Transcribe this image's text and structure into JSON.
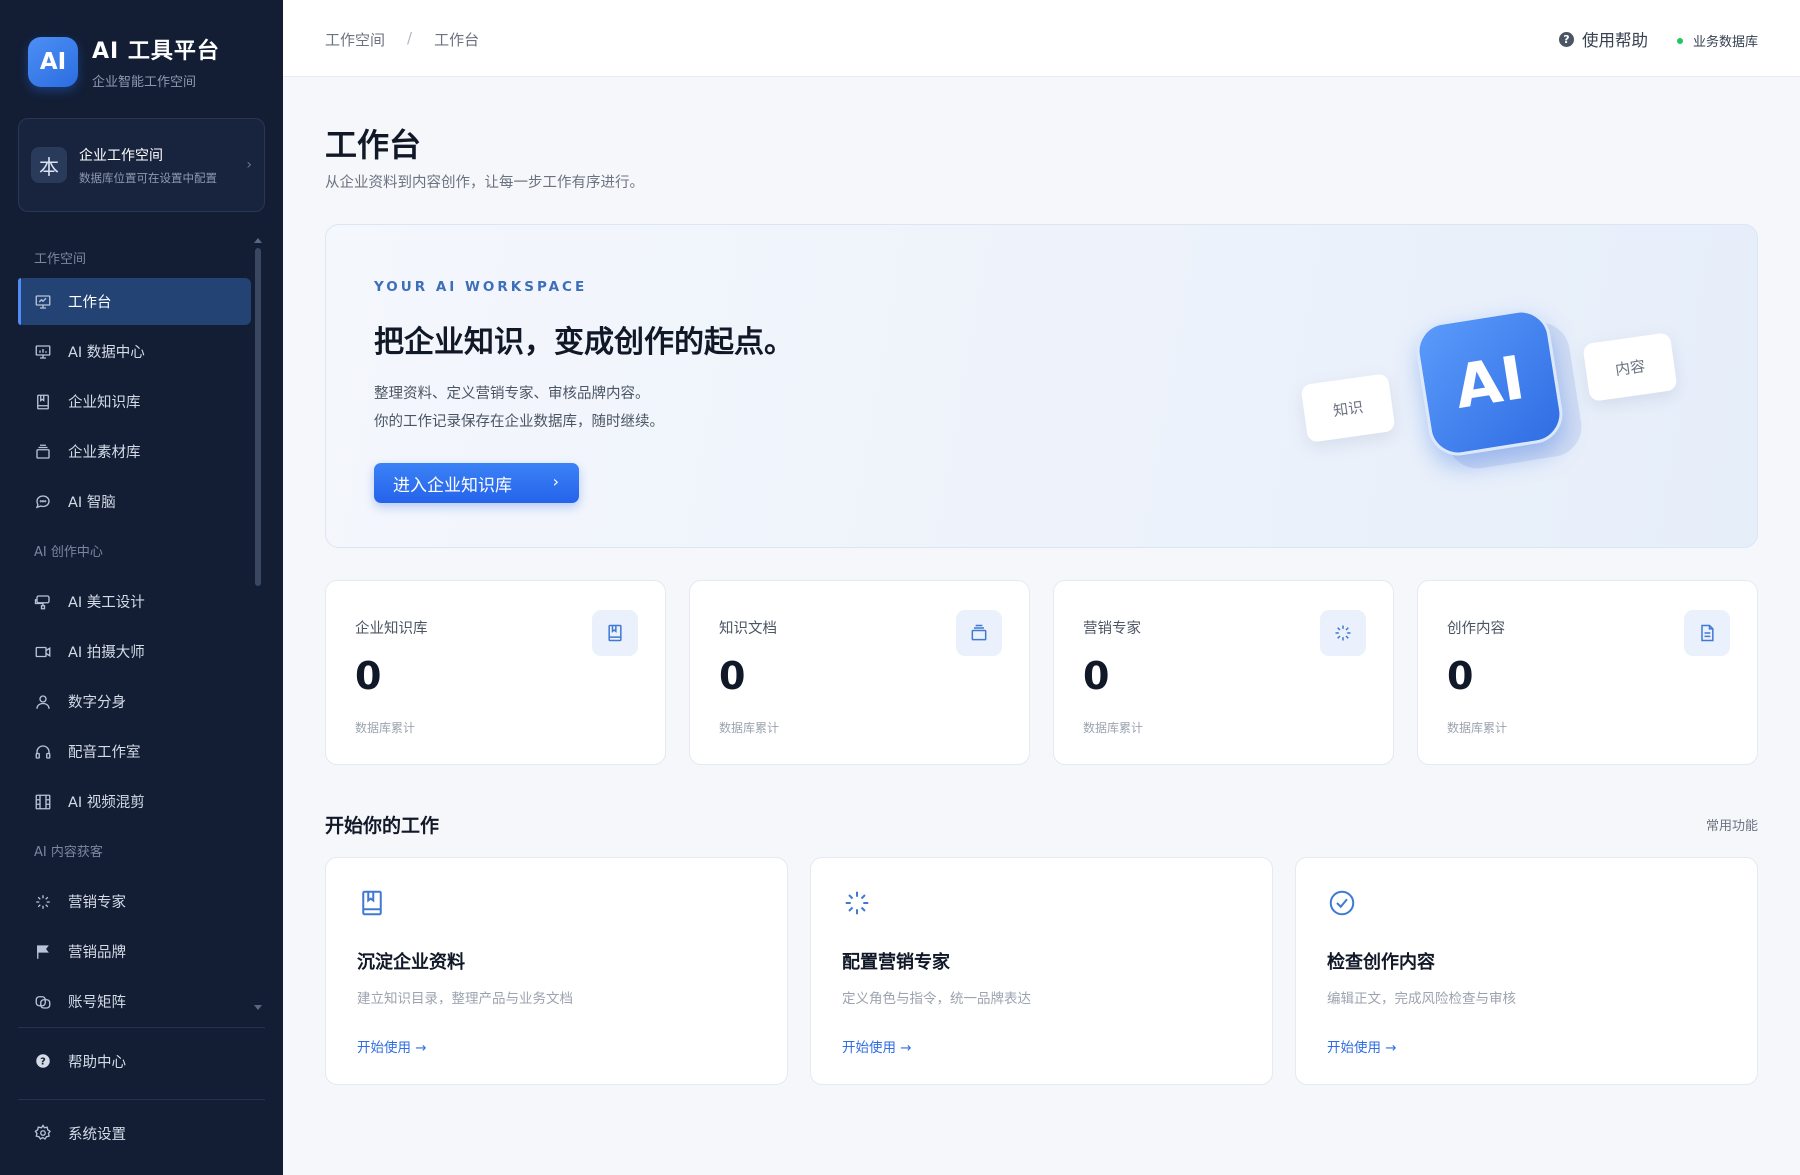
{
  "brand": {
    "logo": "AI",
    "title": "AI 工具平台",
    "subtitle": "企业智能工作空间"
  },
  "workspace": {
    "avatar": "本",
    "title": "企业工作空间",
    "desc": "数据库位置可在设置中配置",
    "chevron": "›"
  },
  "sidebar": {
    "sections": [
      {
        "label": "工作空间",
        "items": [
          {
            "label": "工作台",
            "icon": "presentation-icon",
            "active": true
          },
          {
            "label": "AI 数据中心",
            "icon": "chart-board-icon"
          },
          {
            "label": "企业知识库",
            "icon": "book-icon"
          },
          {
            "label": "企业素材库",
            "icon": "layers-icon"
          },
          {
            "label": "AI 智脑",
            "icon": "chat-bubble-icon"
          }
        ]
      },
      {
        "label": "AI 创作中心",
        "items": [
          {
            "label": "AI 美工设计",
            "icon": "palette-icon"
          },
          {
            "label": "AI 拍摄大师",
            "icon": "video-camera-icon"
          },
          {
            "label": "数字分身",
            "icon": "user-icon"
          },
          {
            "label": "配音工作室",
            "icon": "headphones-icon"
          },
          {
            "label": "AI 视频混剪",
            "icon": "film-icon"
          }
        ]
      },
      {
        "label": "AI 内容获客",
        "items": [
          {
            "label": "营销专家",
            "icon": "sparkle-icon"
          },
          {
            "label": "营销品牌",
            "icon": "flag-icon"
          },
          {
            "label": "账号矩阵",
            "icon": "accounts-icon"
          }
        ]
      }
    ],
    "help": {
      "label": "帮助中心",
      "icon": "question-circle-icon"
    },
    "settings": {
      "label": "系统设置",
      "icon": "gear-icon"
    }
  },
  "topbar": {
    "breadcrumb": [
      "工作空间",
      "工作台"
    ],
    "breadcrumb_sep": "/",
    "help_label": "使用帮助",
    "help_icon_glyph": "?",
    "db_status": "业务数据库",
    "db_status_color": "#22c55e"
  },
  "page": {
    "title": "工作台",
    "subtitle": "从企业资料到内容创作，让每一步工作有序进行。"
  },
  "hero": {
    "eyebrow": "YOUR AI WORKSPACE",
    "title": "把企业知识，变成创作的起点。",
    "line1": "整理资料、定义营销专家、审核品牌内容。",
    "line2": "你的工作记录保存在企业数据库，随时继续。",
    "button": "进入企业知识库",
    "button_chevron": "›",
    "art_logo": "AI",
    "tag_left": "知识",
    "tag_right": "内容"
  },
  "stats": [
    {
      "label": "企业知识库",
      "value": "0",
      "foot": "数据库累计",
      "icon": "book-icon"
    },
    {
      "label": "知识文档",
      "value": "0",
      "foot": "数据库累计",
      "icon": "layers-icon"
    },
    {
      "label": "营销专家",
      "value": "0",
      "foot": "数据库累计",
      "icon": "sparkle-icon"
    },
    {
      "label": "创作内容",
      "value": "0",
      "foot": "数据库累计",
      "icon": "document-icon"
    }
  ],
  "work_section": {
    "title": "开始你的工作",
    "link": "常用功能"
  },
  "features": [
    {
      "title": "沉淀企业资料",
      "desc": "建立知识目录，整理产品与业务文档",
      "link": "开始使用 →",
      "icon": "book-icon"
    },
    {
      "title": "配置营销专家",
      "desc": "定义角色与指令，统一品牌表达",
      "link": "开始使用 →",
      "icon": "sparkle-icon"
    },
    {
      "title": "检查创作内容",
      "desc": "编辑正文，完成风险检查与审核",
      "link": "开始使用 →",
      "icon": "check-circle-icon"
    }
  ],
  "colors": {
    "sidebar_bg": "#131e35",
    "accent": "#2f6de3",
    "active_bg": "#234374"
  }
}
